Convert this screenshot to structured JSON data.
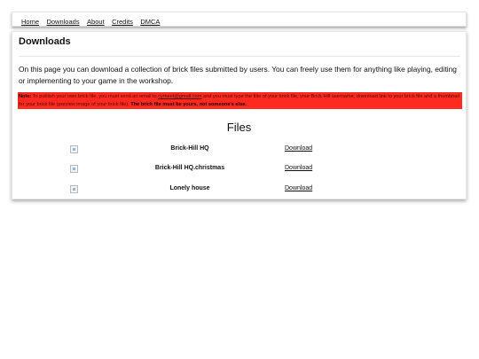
{
  "nav": [
    "Home",
    "Downloads",
    "About",
    "Credits",
    "DMCA"
  ],
  "page": {
    "title": "Downloads",
    "intro": "On this page you can download a collection of brick files submitted by users. You can freely use them for anything like playing, editing or implementing to your game in the workshop.",
    "note": {
      "label": "Note:",
      "text_before": " To publish your own brick file, you must send an email to ",
      "email": "cymeet@gmail.com",
      "text_after": " and you must type the title of your brick file, your Brick Hill username, download link to your brick file and a thumbnail for your brick file (preview image of your brick file). ",
      "bold": "The brick file must be yours, not someone's else."
    },
    "files_title": "Files",
    "files": [
      {
        "name": "Brick-Hill HQ",
        "action": "Download"
      },
      {
        "name": "Brick-Hill HQ.christmas",
        "action": "Download"
      },
      {
        "name": "Lonely house",
        "action": "Download"
      }
    ]
  }
}
